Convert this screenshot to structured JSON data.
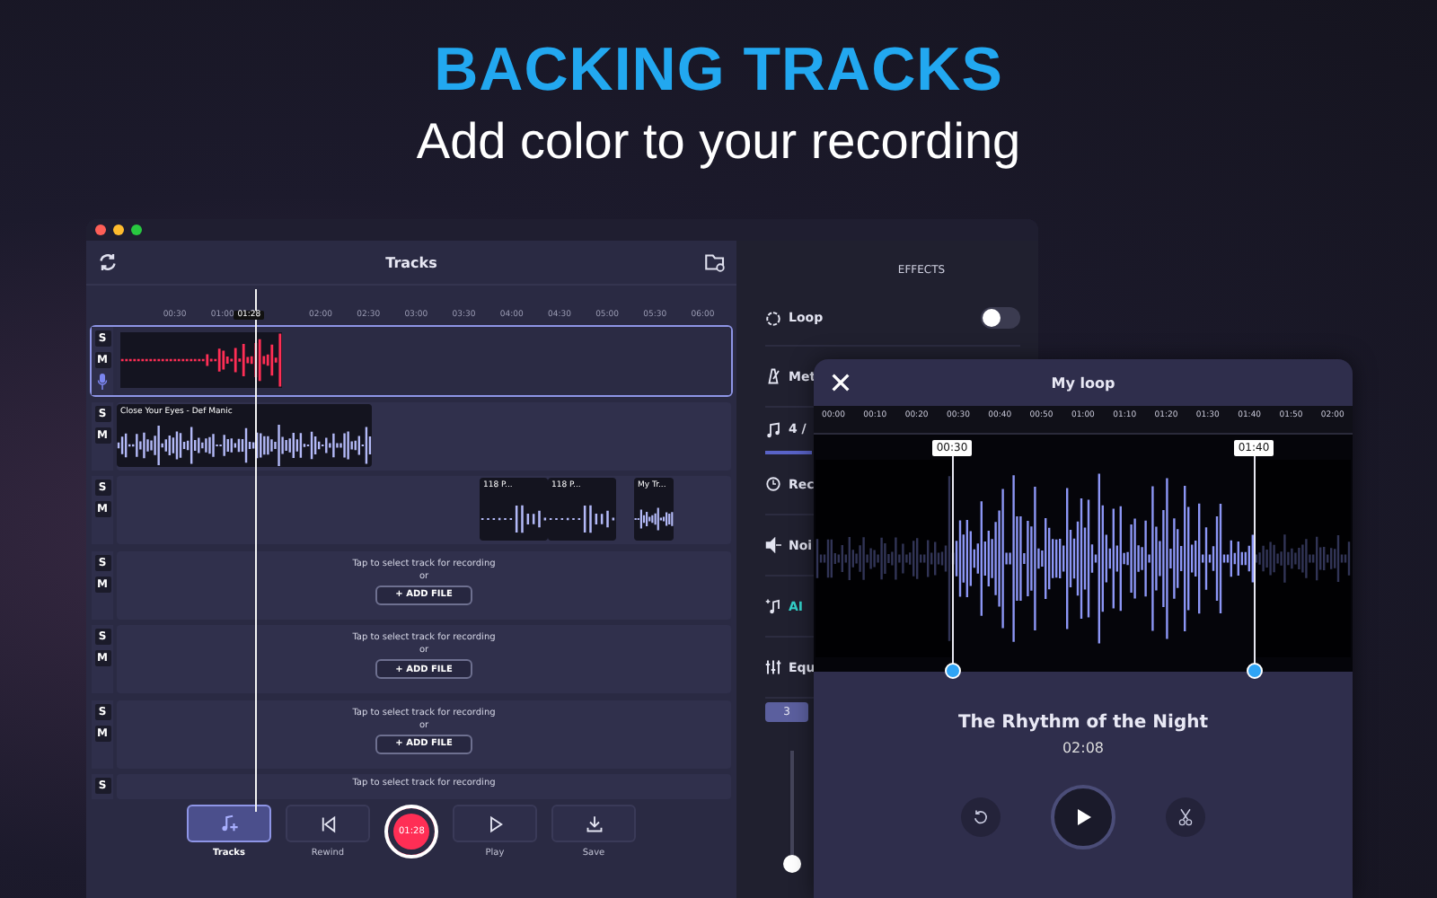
{
  "headline": {
    "title": "BACKING TRACKS",
    "subtitle": "Add color to your recording"
  },
  "window": {
    "title": "Tracks"
  },
  "ruler": {
    "labels": [
      "00:30",
      "01:00",
      "02:00",
      "02:30",
      "03:00",
      "03:30",
      "04:00",
      "04:30",
      "05:00",
      "05:30",
      "06:00"
    ],
    "playhead": "01:28"
  },
  "tracks": [
    {
      "kind": "recording",
      "selected": true,
      "solo": "S",
      "mute": "M"
    },
    {
      "kind": "clips",
      "selected": false,
      "solo": "S",
      "mute": "M",
      "clips": [
        "Close Your Eyes - Def Manic"
      ]
    },
    {
      "kind": "clips",
      "selected": false,
      "solo": "S",
      "mute": "M",
      "clips": [
        "118 P...",
        "118 P...",
        "My Tr..."
      ]
    },
    {
      "kind": "empty",
      "selected": false,
      "solo": "S",
      "mute": "M",
      "hint": "Tap to select track for recording",
      "or": "or",
      "add": "+ ADD FILE"
    },
    {
      "kind": "empty",
      "selected": false,
      "solo": "S",
      "mute": "M",
      "hint": "Tap to select track for recording",
      "or": "or",
      "add": "+ ADD FILE"
    },
    {
      "kind": "empty",
      "selected": false,
      "solo": "S",
      "mute": "M",
      "hint": "Tap to select track for recording",
      "or": "or",
      "add": "+ ADD FILE"
    },
    {
      "kind": "partial",
      "selected": false,
      "solo": "S",
      "hint": "Tap to select track for recording"
    }
  ],
  "toolbar": [
    {
      "kind": "tracks",
      "label": "Tracks",
      "selected": true
    },
    {
      "kind": "rewind",
      "label": "Rewind",
      "selected": false
    },
    {
      "kind": "record",
      "time": "01:28"
    },
    {
      "kind": "play",
      "label": "Play",
      "selected": false
    },
    {
      "kind": "save",
      "label": "Save",
      "selected": false
    }
  ],
  "effects": {
    "title": "EFFECTS",
    "loop": {
      "label": "Loop",
      "on": false
    },
    "items": [
      {
        "kind": "metronome",
        "label": "Met"
      },
      {
        "kind": "note",
        "label": "4 /"
      },
      {
        "kind": "timer",
        "label": "Rec"
      },
      {
        "kind": "noise",
        "label": "Noi"
      },
      {
        "kind": "ai",
        "label": "AI"
      },
      {
        "kind": "eq",
        "label": "Equ"
      }
    ],
    "chip": "3",
    "slider": {
      "level": 0.02
    }
  },
  "loop_dialog": {
    "title": "My loop",
    "ruler": [
      "00:00",
      "00:10",
      "00:20",
      "00:30",
      "00:40",
      "00:50",
      "01:00",
      "01:10",
      "01:20",
      "01:30",
      "01:40",
      "01:50",
      "02:00"
    ],
    "start": "00:30",
    "end": "01:40",
    "song": "The Rhythm of the Night",
    "duration": "02:08"
  }
}
